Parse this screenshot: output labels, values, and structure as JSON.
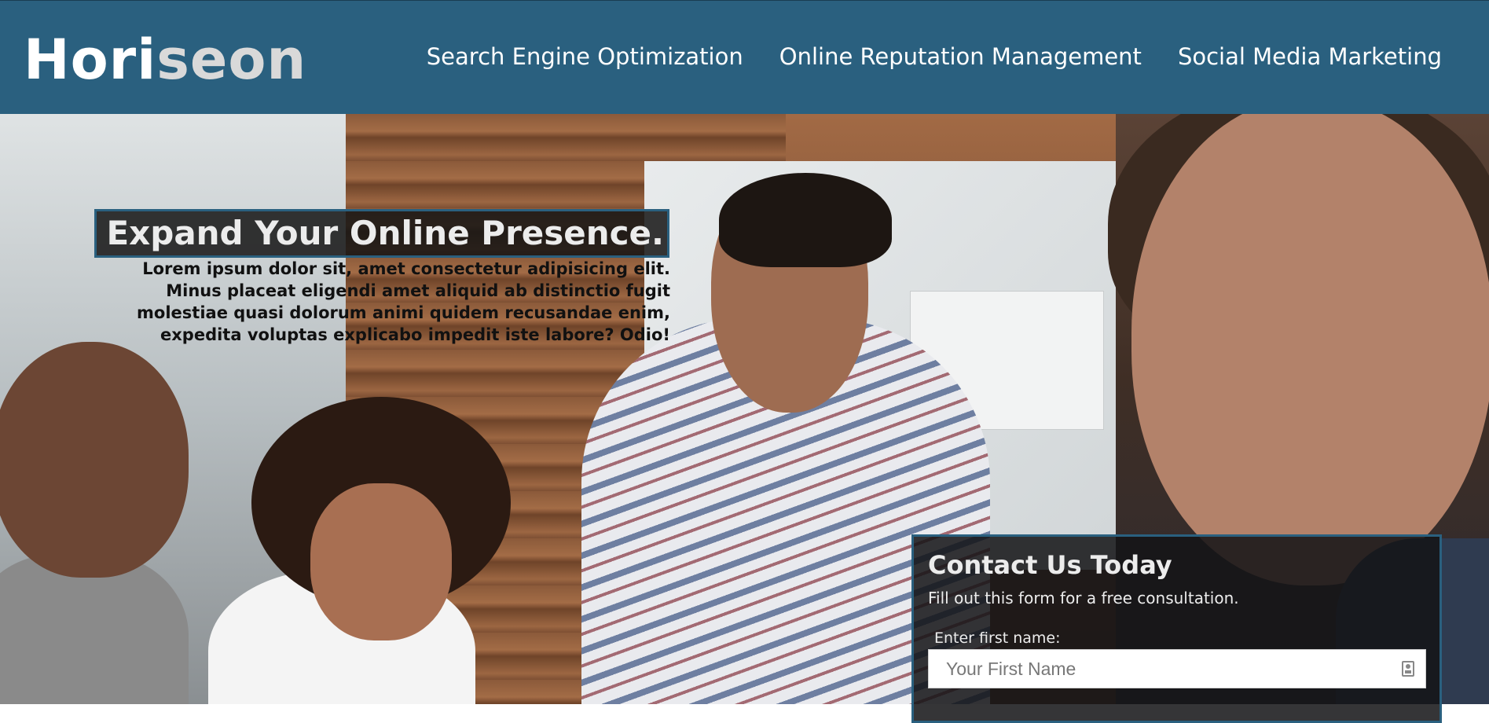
{
  "header": {
    "logo_main": "Hori",
    "logo_accent": "seon",
    "nav": [
      {
        "label": "Search Engine Optimization"
      },
      {
        "label": "Online Reputation Management"
      },
      {
        "label": "Social Media Marketing"
      }
    ],
    "background_color": "#2a607f"
  },
  "hero": {
    "headline": "Expand Your Online Presence.",
    "intro": "Lorem ipsum dolor sit, amet consectetur adipisicing elit. Minus placeat eligendi amet aliquid ab distinctio fugit molestiae quasi dolorum animi quidem recusandae enim, expedita voluptas explicabo impedit iste labore? Odio!"
  },
  "contact": {
    "title": "Contact Us Today",
    "subtitle": "Fill out this form for a free consultation.",
    "first_name_label": "Enter first name:",
    "first_name_placeholder": "Your First Name",
    "first_name_value": "",
    "field_icon": "contact-card-icon"
  }
}
